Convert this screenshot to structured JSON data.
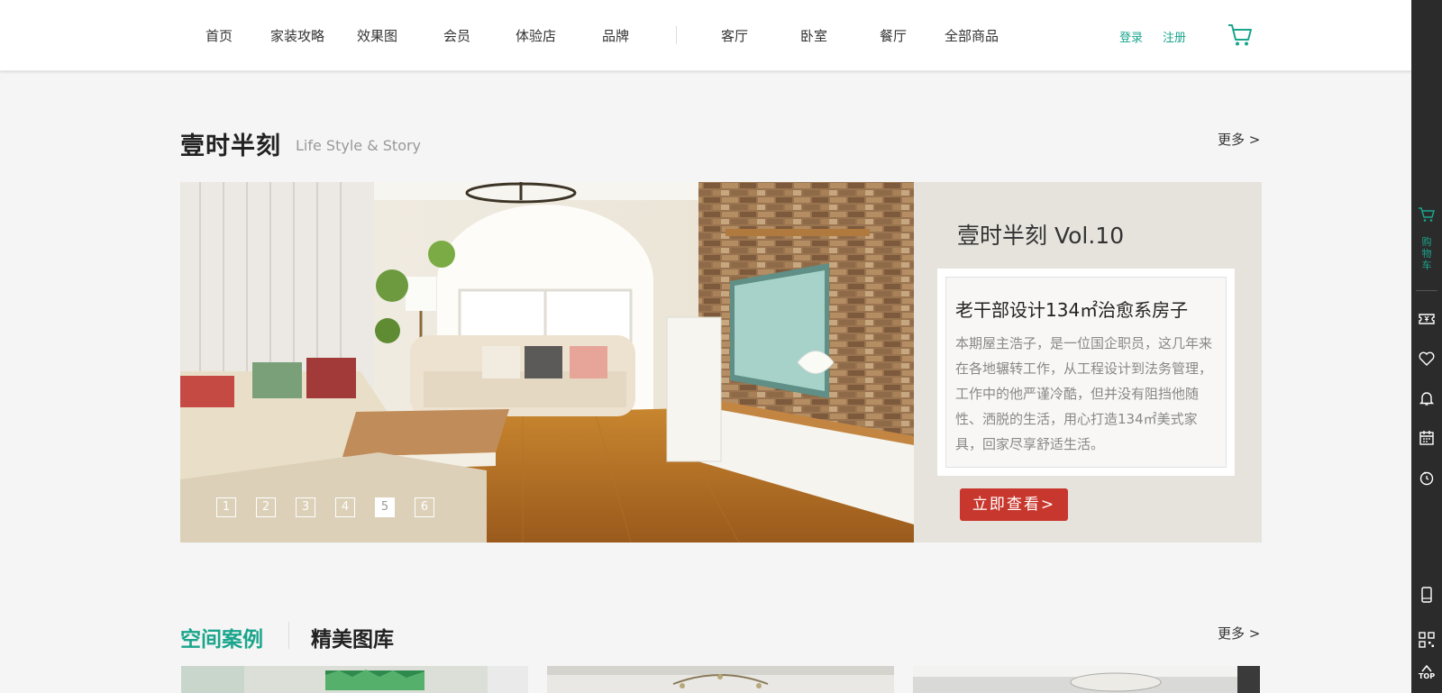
{
  "nav": {
    "items": [
      "首页",
      "家装攻略",
      "效果图",
      "会员",
      "体验店",
      "品牌",
      "客厅",
      "卧室",
      "餐厅",
      "全部商品"
    ],
    "login": "登录",
    "register": "注册"
  },
  "sidebar": {
    "cart_label": "购物车",
    "top_label": "TOP"
  },
  "section1": {
    "title": "壹时半刻",
    "subtitle": "Life Style & Story",
    "more": "更多 >",
    "slider": {
      "pages": [
        "1",
        "2",
        "3",
        "4",
        "5",
        "6"
      ],
      "active_index": 4
    },
    "feature": {
      "vol_title": "壹时半刻 Vol.10",
      "card_title": "老干部设计134㎡治愈系房子",
      "card_text": "本期屋主浩子，是一位国企职员，这几年来在各地辗转工作，从工程设计到法务管理，工作中的他严谨冷酷，但并没有阻挡他随性、洒脱的生活，用心打造134㎡美式家具，回家尽享舒适生活。",
      "button": "立即查看>"
    }
  },
  "section2": {
    "tab_active": "空间案例",
    "tab_inactive": "精美图库",
    "more": "更多 >"
  },
  "colors": {
    "accent": "#1aa58c",
    "button_red": "#c8372d",
    "sidebar_bg": "#2b2b2b"
  }
}
